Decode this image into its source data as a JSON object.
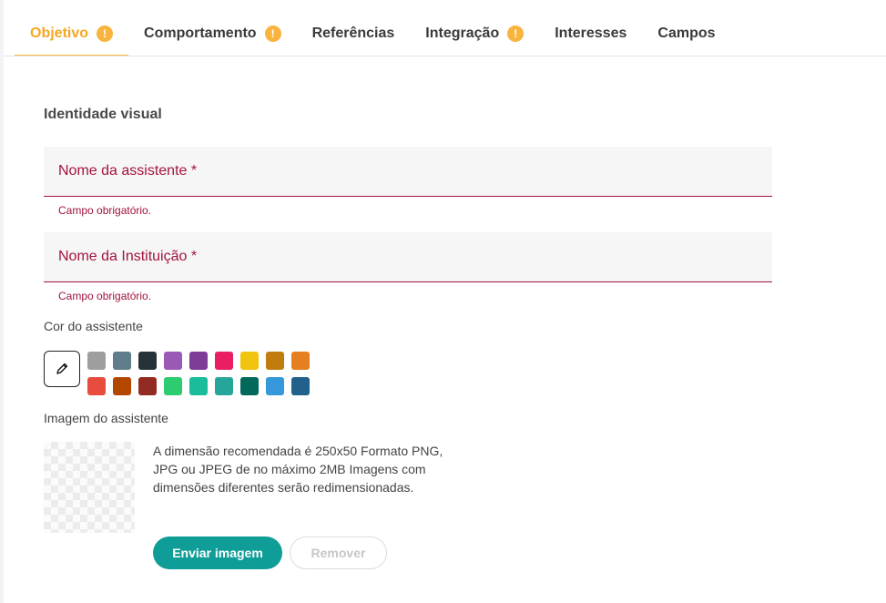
{
  "tabs": [
    {
      "label": "Objetivo",
      "warning": "!",
      "active": true
    },
    {
      "label": "Comportamento",
      "warning": "!"
    },
    {
      "label": "Referências"
    },
    {
      "label": "Integração",
      "warning": "!"
    },
    {
      "label": "Interesses"
    },
    {
      "label": "Campos"
    }
  ],
  "form": {
    "section_title": "Identidade visual",
    "assistant_name": {
      "label": "Nome da assistente *",
      "value": "",
      "error": "Campo obrigatório."
    },
    "institution_name": {
      "label": "Nome da Instituição *",
      "value": "",
      "error": "Campo obrigatório."
    },
    "color_label": "Cor do assistente",
    "colors_row1": [
      "#9e9e9e",
      "#607d8b",
      "#263238",
      "#9b59b6",
      "#7d3c98",
      "#e91e63",
      "#f1c40f",
      "#c27c0e",
      "#e67e22"
    ],
    "colors_row2": [
      "#e74c3c",
      "#b34700",
      "#922b21",
      "#2ecc71",
      "#1abc9c",
      "#26a69a",
      "#00695c",
      "#3498db",
      "#21618c"
    ],
    "image_label": "Imagem do assistente",
    "image_description": "A dimensão recomendada é 250x50 Formato PNG, JPG ou JPEG de no máximo 2MB Imagens com dimensões diferentes serão redimensionadas.",
    "upload_button": "Enviar imagem",
    "remove_button": "Remover"
  },
  "colors": {
    "accent": "#f5a623",
    "error": "#a3143c",
    "primary": "#0f9d97"
  }
}
